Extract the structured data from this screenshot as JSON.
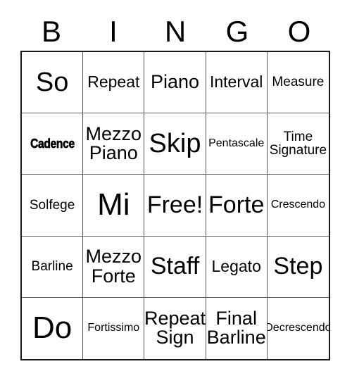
{
  "card": {
    "title": "BINGO",
    "header_letters": [
      "B",
      "I",
      "N",
      "G",
      "O"
    ],
    "grid_size": "5x5",
    "free_space": "Free!",
    "colors": {
      "background": "#ffffff",
      "text": "#000000",
      "outer_border": "#1a1a1a",
      "inner_border": "#5a5a5a"
    },
    "cells": [
      {
        "text": "So",
        "size": "xl",
        "style": "normal"
      },
      {
        "text": "Repeat",
        "size": "sm",
        "style": "normal"
      },
      {
        "text": "Piano",
        "size": "md",
        "style": "normal"
      },
      {
        "text": "Interval",
        "size": "sm",
        "style": "normal"
      },
      {
        "text": "Measure",
        "size": "xs",
        "style": "normal"
      },
      {
        "text": "Cadence",
        "size": "xxs",
        "style": "heavy-condensed"
      },
      {
        "text": "Mezzo\nPiano",
        "size": "md",
        "style": "normal"
      },
      {
        "text": "Skip",
        "size": "xl",
        "style": "normal"
      },
      {
        "text": "Pentascale",
        "size": "xxs",
        "style": "normal"
      },
      {
        "text": "Time\nSignature",
        "size": "xs",
        "style": "normal"
      },
      {
        "text": "Solfege",
        "size": "xs",
        "style": "normal"
      },
      {
        "text": "Mi",
        "size": "xxl",
        "style": "normal"
      },
      {
        "text": "Free!",
        "size": "lg",
        "style": "normal"
      },
      {
        "text": "Forte",
        "size": "lg",
        "style": "normal"
      },
      {
        "text": "Crescendo",
        "size": "xxs",
        "style": "normal"
      },
      {
        "text": "Barline",
        "size": "xs",
        "style": "normal"
      },
      {
        "text": "Mezzo\nForte",
        "size": "md",
        "style": "normal"
      },
      {
        "text": "Staff",
        "size": "lg",
        "style": "normal"
      },
      {
        "text": "Legato",
        "size": "sm",
        "style": "normal"
      },
      {
        "text": "Step",
        "size": "lg",
        "style": "normal"
      },
      {
        "text": "Do",
        "size": "xxl",
        "style": "normal"
      },
      {
        "text": "Fortissimo",
        "size": "xxs",
        "style": "normal"
      },
      {
        "text": "Repeat\nSign",
        "size": "md",
        "style": "normal"
      },
      {
        "text": "Final\nBarline",
        "size": "md",
        "style": "normal"
      },
      {
        "text": "Decrescendo",
        "size": "xxs",
        "style": "normal"
      }
    ]
  }
}
